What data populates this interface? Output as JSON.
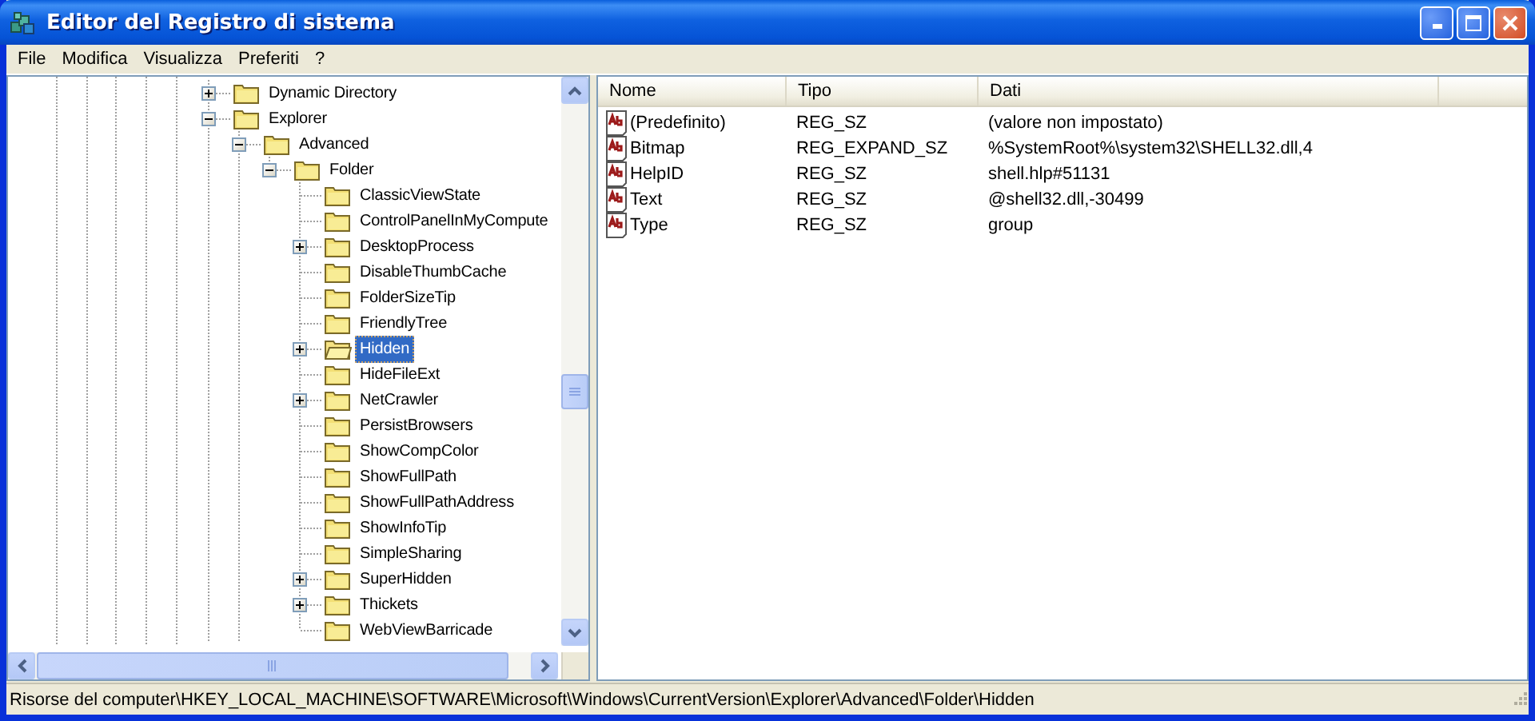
{
  "window": {
    "title": "Editor del Registro di sistema"
  },
  "menu": [
    "File",
    "Modifica",
    "Visualizza",
    "Preferiti",
    "?"
  ],
  "tree": {
    "items": [
      {
        "label": "Dynamic Directory",
        "expanded": false,
        "selected": false
      },
      {
        "label": "Explorer",
        "expanded": true,
        "selected": false,
        "children": [
          {
            "label": "Advanced",
            "expanded": true,
            "selected": false,
            "children": [
              {
                "label": "Folder",
                "expanded": true,
                "selected": false,
                "children": [
                  {
                    "label": "ClassicViewState",
                    "selected": false
                  },
                  {
                    "label": "ControlPanelInMyCompute",
                    "selected": false
                  },
                  {
                    "label": "DesktopProcess",
                    "expanded": false,
                    "selected": false
                  },
                  {
                    "label": "DisableThumbCache",
                    "selected": false
                  },
                  {
                    "label": "FolderSizeTip",
                    "selected": false
                  },
                  {
                    "label": "FriendlyTree",
                    "selected": false
                  },
                  {
                    "label": "Hidden",
                    "expanded": false,
                    "selected": true
                  },
                  {
                    "label": "HideFileExt",
                    "selected": false
                  },
                  {
                    "label": "NetCrawler",
                    "expanded": false,
                    "selected": false
                  },
                  {
                    "label": "PersistBrowsers",
                    "selected": false
                  },
                  {
                    "label": "ShowCompColor",
                    "selected": false
                  },
                  {
                    "label": "ShowFullPath",
                    "selected": false
                  },
                  {
                    "label": "ShowFullPathAddress",
                    "selected": false
                  },
                  {
                    "label": "ShowInfoTip",
                    "selected": false
                  },
                  {
                    "label": "SimpleSharing",
                    "selected": false
                  },
                  {
                    "label": "SuperHidden",
                    "expanded": false,
                    "selected": false
                  },
                  {
                    "label": "Thickets",
                    "expanded": false,
                    "selected": false
                  },
                  {
                    "label": "WebViewBarricade",
                    "selected": false
                  }
                ]
              }
            ]
          }
        ]
      }
    ]
  },
  "values": {
    "columns": [
      "Nome",
      "Tipo",
      "Dati"
    ],
    "rows": [
      {
        "name": "(Predefinito)",
        "type": "REG_SZ",
        "data": "(valore non impostato)"
      },
      {
        "name": "Bitmap",
        "type": "REG_EXPAND_SZ",
        "data": "%SystemRoot%\\system32\\SHELL32.dll,4"
      },
      {
        "name": "HelpID",
        "type": "REG_SZ",
        "data": "shell.hlp#51131"
      },
      {
        "name": "Text",
        "type": "REG_SZ",
        "data": "@shell32.dll,-30499"
      },
      {
        "name": "Type",
        "type": "REG_SZ",
        "data": "group"
      }
    ]
  },
  "status_bar": "Risorse del computer\\HKEY_LOCAL_MACHINE\\SOFTWARE\\Microsoft\\Windows\\CurrentVersion\\Explorer\\Advanced\\Folder\\Hidden"
}
